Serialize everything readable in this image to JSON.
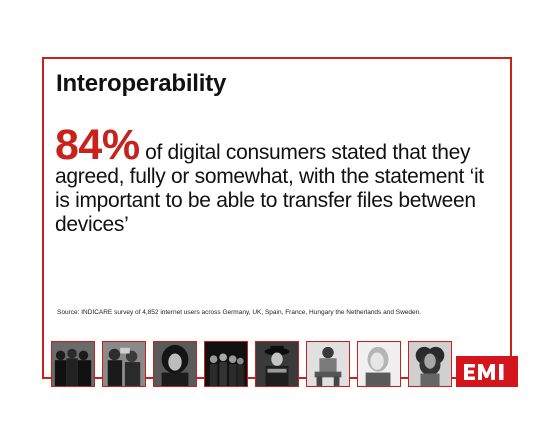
{
  "slide": {
    "title": "Interoperability",
    "stat_value": "84%",
    "stat_text": " of digital consumers stated that they agreed, fully or somewhat, with the statement ‘it is important to be able to transfer files between devices’",
    "source": "Source: INDICARE survey of 4,852 internet users across Germany, UK, Spain, France, Hungary the Netherlands and Sweden."
  },
  "colors": {
    "accent": "#c8221c",
    "logo_bg": "#d4161c",
    "text": "#111111"
  },
  "logo": {
    "text": "EMI"
  },
  "photos": [
    {
      "name": "photo-group-band",
      "tone": "#2b2b2b"
    },
    {
      "name": "photo-group-performers",
      "tone": "#3a3a3a"
    },
    {
      "name": "photo-portrait-dark-hair",
      "tone": "#4a4a4a"
    },
    {
      "name": "photo-band-lineup",
      "tone": "#1e1e1e"
    },
    {
      "name": "photo-performer-hat",
      "tone": "#2e2e2e"
    },
    {
      "name": "photo-seated-artist",
      "tone": "#cfcfcf"
    },
    {
      "name": "photo-portrait-light",
      "tone": "#d9d9d9"
    },
    {
      "name": "photo-portrait-curly-hair",
      "tone": "#bdbdbd"
    }
  ]
}
